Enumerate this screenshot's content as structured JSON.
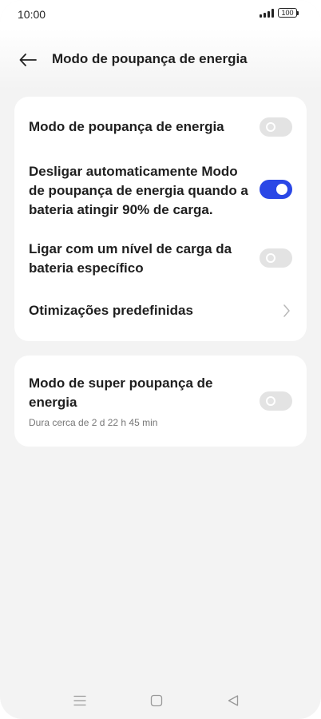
{
  "status_bar": {
    "time": "10:00",
    "battery": "100"
  },
  "header": {
    "title": "Modo de poupança de energia",
    "back_icon": "arrow-left-icon"
  },
  "settings": [
    {
      "label": "Modo de poupança de energia",
      "control": "toggle",
      "enabled": false
    },
    {
      "label": "Desligar automaticamente Modo de poupança de energia quando a bateria atingir 90% de carga.",
      "control": "toggle",
      "enabled": true
    },
    {
      "label": "Ligar com um nível de carga da bateria específico",
      "control": "toggle",
      "enabled": false
    },
    {
      "label": "Otimizações predefinidas",
      "control": "chevron"
    }
  ],
  "super_saving": {
    "label": "Modo de super poupança de energia",
    "subtitle": "Dura cerca de 2 d 22 h 45 min",
    "enabled": false
  },
  "nav_bar": {
    "icons": [
      "menu-icon",
      "home-square-icon",
      "back-triangle-icon"
    ]
  },
  "colors": {
    "accent": "#2a47e6",
    "toggle_off": "#e3e3e3",
    "background": "#f3f3f3",
    "card": "#ffffff"
  }
}
